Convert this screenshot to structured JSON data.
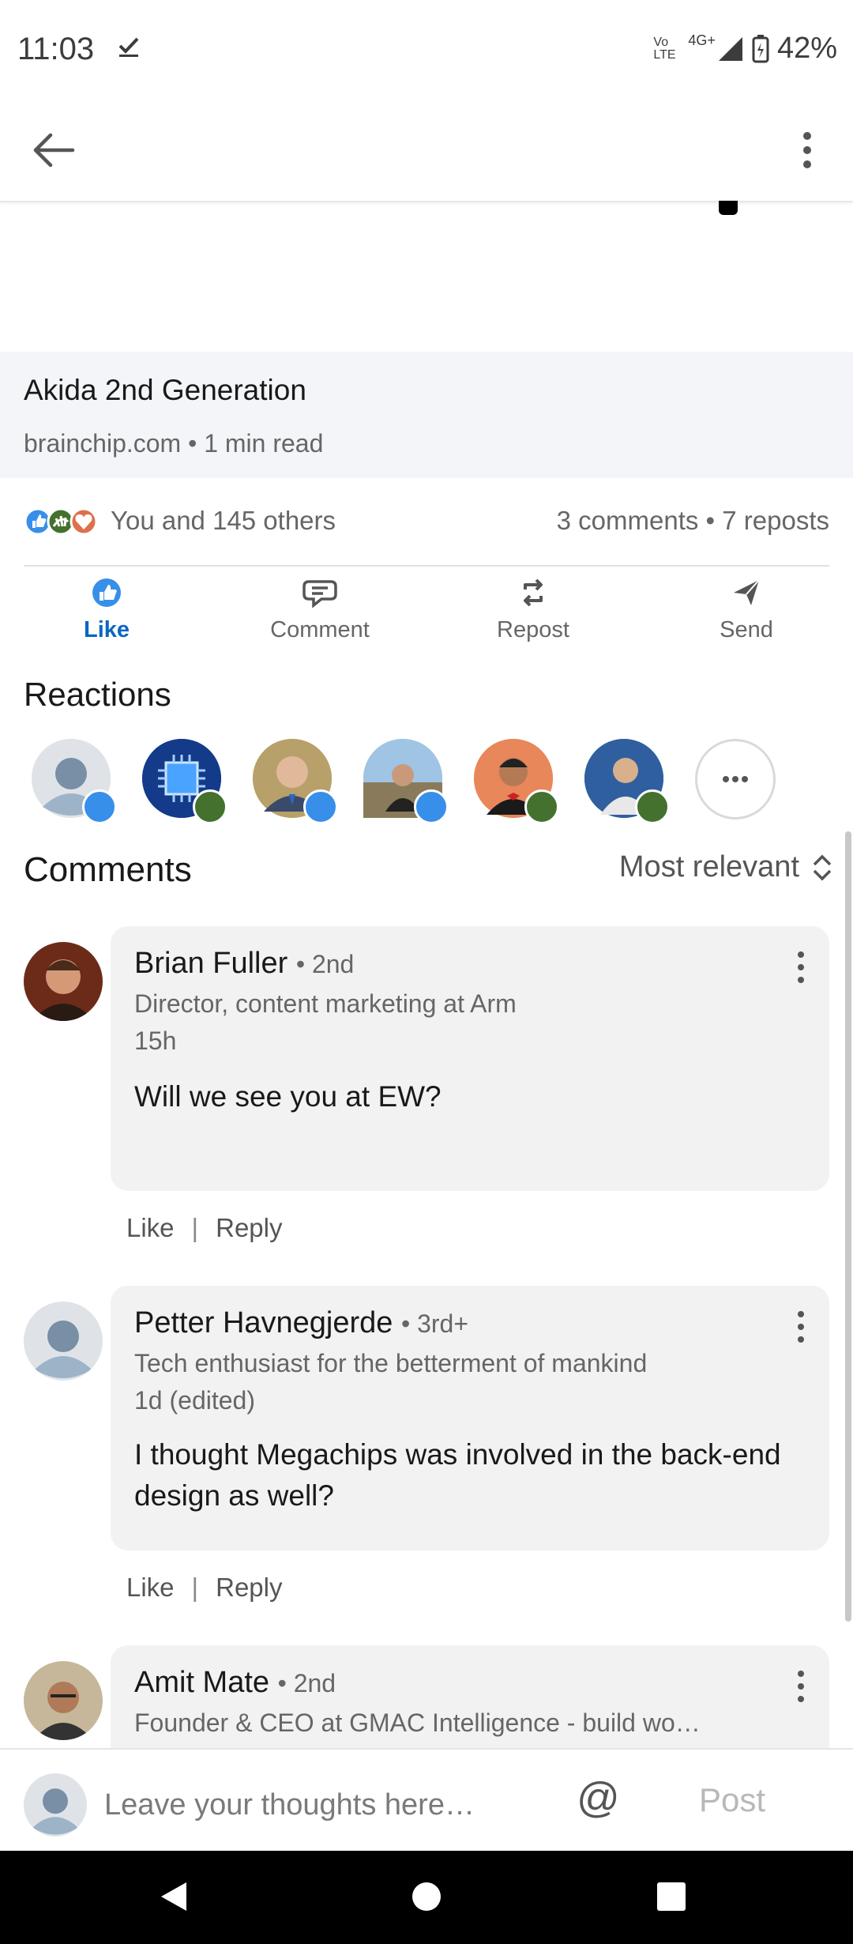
{
  "status_bar": {
    "time": "11:03",
    "network": "4G+",
    "volte": "Vo LTE",
    "battery": "42%"
  },
  "article": {
    "title": "Akida 2nd Generation",
    "meta": "brainchip.com • 1 min read"
  },
  "social": {
    "likes_text": "You and 145 others",
    "comments_reposts": "3 comments • 7 reposts"
  },
  "actions": [
    {
      "label": "Like",
      "icon": "like-icon",
      "active": true
    },
    {
      "label": "Comment",
      "icon": "comment-icon"
    },
    {
      "label": "Repost",
      "icon": "repost-icon"
    },
    {
      "label": "Send",
      "icon": "send-icon"
    }
  ],
  "reactions": {
    "title": "Reactions"
  },
  "comments_header": {
    "title": "Comments",
    "sort": "Most relevant"
  },
  "comments": [
    {
      "name": "Brian Fuller",
      "degree": "• 2nd",
      "headline": "Director, content marketing at Arm",
      "time": "15h",
      "text": "Will we see you at EW?",
      "like": "Like",
      "reply": "Reply"
    },
    {
      "name": "Petter Havnegjerde",
      "degree": "• 3rd+",
      "headline": "Tech enthusiast for the betterment of mankind",
      "time": "1d (edited)",
      "text": "I thought Megachips was involved in the back-end design as well?",
      "like": "Like",
      "reply": "Reply"
    },
    {
      "name": "Amit Mate",
      "degree": "• 2nd",
      "headline": "Founder & CEO at GMAC Intelligence - build wo…"
    }
  ],
  "composer": {
    "placeholder": "Leave your thoughts here…",
    "at": "@",
    "post": "Post"
  },
  "colors": {
    "accent": "#0a66c2",
    "bubble": "#f2f2f2"
  }
}
